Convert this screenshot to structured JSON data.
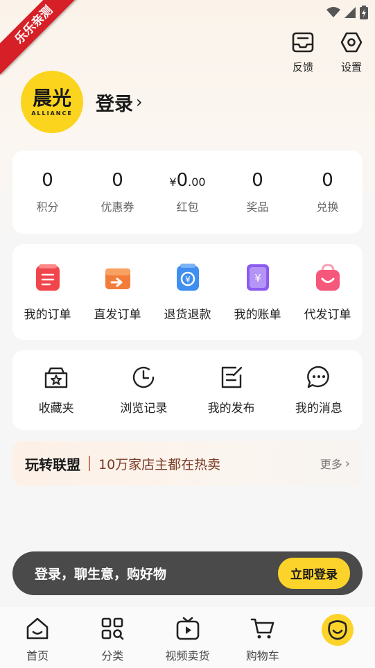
{
  "ribbon": {
    "text": "乐乐亲测"
  },
  "top_actions": [
    {
      "label": "反馈",
      "icon": "feedback-icon"
    },
    {
      "label": "设置",
      "icon": "settings-icon"
    }
  ],
  "profile": {
    "logo_main": "晨光",
    "logo_sub": "ALLIANCE",
    "login_text": "登录",
    "chevron": "›"
  },
  "stats": [
    {
      "value": "0",
      "label": "积分"
    },
    {
      "value": "0",
      "label": "优惠券"
    },
    {
      "currency": "¥",
      "value": "0",
      "decimals": ".00",
      "label": "红包"
    },
    {
      "value": "0",
      "label": "奖品"
    },
    {
      "value": "0",
      "label": "兑换"
    }
  ],
  "orders": [
    {
      "label": "我的订单",
      "icon": "order-list-icon",
      "color": "#f0454b"
    },
    {
      "label": "直发订单",
      "icon": "direct-ship-icon",
      "color": "#f27d3a"
    },
    {
      "label": "退货退款",
      "icon": "refund-icon",
      "color": "#3f8ef0"
    },
    {
      "label": "我的账单",
      "icon": "bill-icon",
      "color": "#8b5cf0"
    },
    {
      "label": "代发订单",
      "icon": "proxy-order-icon",
      "color": "#f5587a"
    }
  ],
  "tools": [
    {
      "label": "收藏夹",
      "icon": "favorites-icon"
    },
    {
      "label": "浏览记录",
      "icon": "history-icon"
    },
    {
      "label": "我的发布",
      "icon": "publish-icon"
    },
    {
      "label": "我的消息",
      "icon": "message-icon"
    }
  ],
  "banner": {
    "brand": "玩转联盟",
    "slogan": "10万家店主都在热卖",
    "more": "更多",
    "chevron": "›"
  },
  "login_bar": {
    "text": "登录，聊生意，购好物",
    "button": "立即登录"
  },
  "tabs": [
    {
      "label": "首页",
      "icon": "home-icon"
    },
    {
      "label": "分类",
      "icon": "category-icon"
    },
    {
      "label": "视频卖货",
      "icon": "video-icon"
    },
    {
      "label": "购物车",
      "icon": "cart-icon"
    },
    {
      "label": "",
      "icon": "me-icon"
    }
  ]
}
